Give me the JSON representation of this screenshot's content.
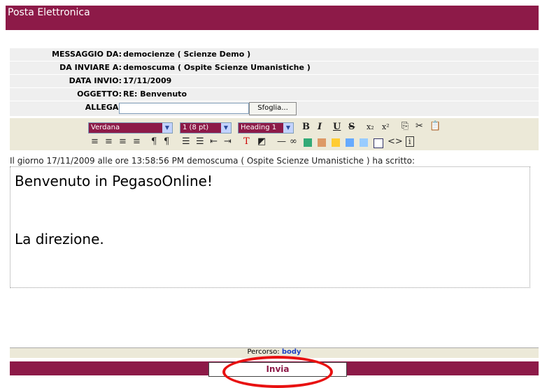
{
  "app": {
    "title": "Posta Elettronica"
  },
  "header": {
    "from_label": "MESSAGGIO DA:",
    "from_value": "democienze ( Scienze Demo )",
    "to_label": "DA INVIARE A:",
    "to_value": "demoscuma ( Ospite Scienze Umanistiche )",
    "date_label": "DATA INVIO:",
    "date_value": "17/11/2009",
    "subject_label": "OGGETTO:",
    "subject_value": "RE: Benvenuto",
    "attach_label": "ALLEGA:",
    "attach_value": "",
    "browse_label": "Sfoglia..."
  },
  "toolbar": {
    "font": "Verdana",
    "size": "1 (8 pt)",
    "format": "Heading 1",
    "bold": "B",
    "italic": "I",
    "underline": "U",
    "strike": "S"
  },
  "message": {
    "quote_line": "Il giorno 17/11/2009 alle ore 13:58:56 PM demoscuma ( Ospite Scienze Umanistiche ) ha scritto:",
    "line1": "Benvenuto in PegasoOnline!",
    "line2": "La direzione."
  },
  "status": {
    "path_label": "Percorso:",
    "path_value": "body"
  },
  "footer": {
    "send_label": "Invia"
  },
  "colors": {
    "accent": "#8d1a48",
    "highlight": "#e81010"
  }
}
